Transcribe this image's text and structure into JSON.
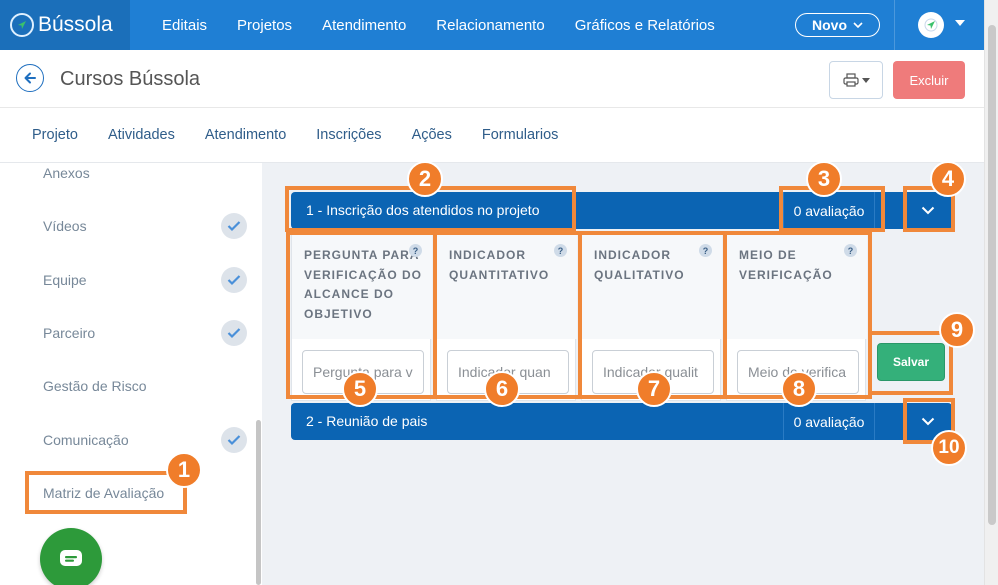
{
  "app": {
    "brand": "Bússola",
    "nav": [
      "Editais",
      "Projetos",
      "Atendimento",
      "Relacionamento",
      "Gráficos e Relatórios"
    ],
    "novo_label": "Novo"
  },
  "header": {
    "title": "Cursos Bússola",
    "excluir_label": "Excluir"
  },
  "tabs": [
    "Projeto",
    "Atividades",
    "Atendimento",
    "Inscrições",
    "Ações",
    "Formularios"
  ],
  "sidebar": {
    "items": [
      {
        "label": "Anexos",
        "checked": false
      },
      {
        "label": "Vídeos",
        "checked": true
      },
      {
        "label": "Equipe",
        "checked": true
      },
      {
        "label": "Parceiro",
        "checked": true
      },
      {
        "label": "Gestão de Risco",
        "checked": false
      },
      {
        "label": "Comunicação",
        "checked": true
      },
      {
        "label": "Matriz de Avaliação",
        "checked": false
      }
    ]
  },
  "matrix": {
    "sections": [
      {
        "title": "1 - Inscrição dos atendidos no projeto",
        "count": "0 avaliação",
        "expanded": true
      },
      {
        "title": "2 - Reunião de pais",
        "count": "0 avaliação",
        "expanded": false
      }
    ],
    "columns": [
      {
        "label": "Pergunta para verificação do alcance do objetivo",
        "placeholder": "Pergunta para v"
      },
      {
        "label": "Indicador quantitativo",
        "placeholder": "Indicador quan"
      },
      {
        "label": "Indicador qualitativo",
        "placeholder": "Indicador qualit"
      },
      {
        "label": "Meio de verificação",
        "placeholder": "Meio de verifica"
      }
    ],
    "help_glyph": "?",
    "salvar_label": "Salvar"
  },
  "annotations": [
    "1",
    "2",
    "3",
    "4",
    "5",
    "6",
    "7",
    "8",
    "9",
    "10"
  ],
  "colors": {
    "topbar": "#1f7fd4",
    "accordion": "#0b64b3",
    "annotation": "#f07d2a",
    "excluir": "#ef7b7b",
    "salvar": "#34b07a",
    "chat": "#2d9a3a"
  }
}
